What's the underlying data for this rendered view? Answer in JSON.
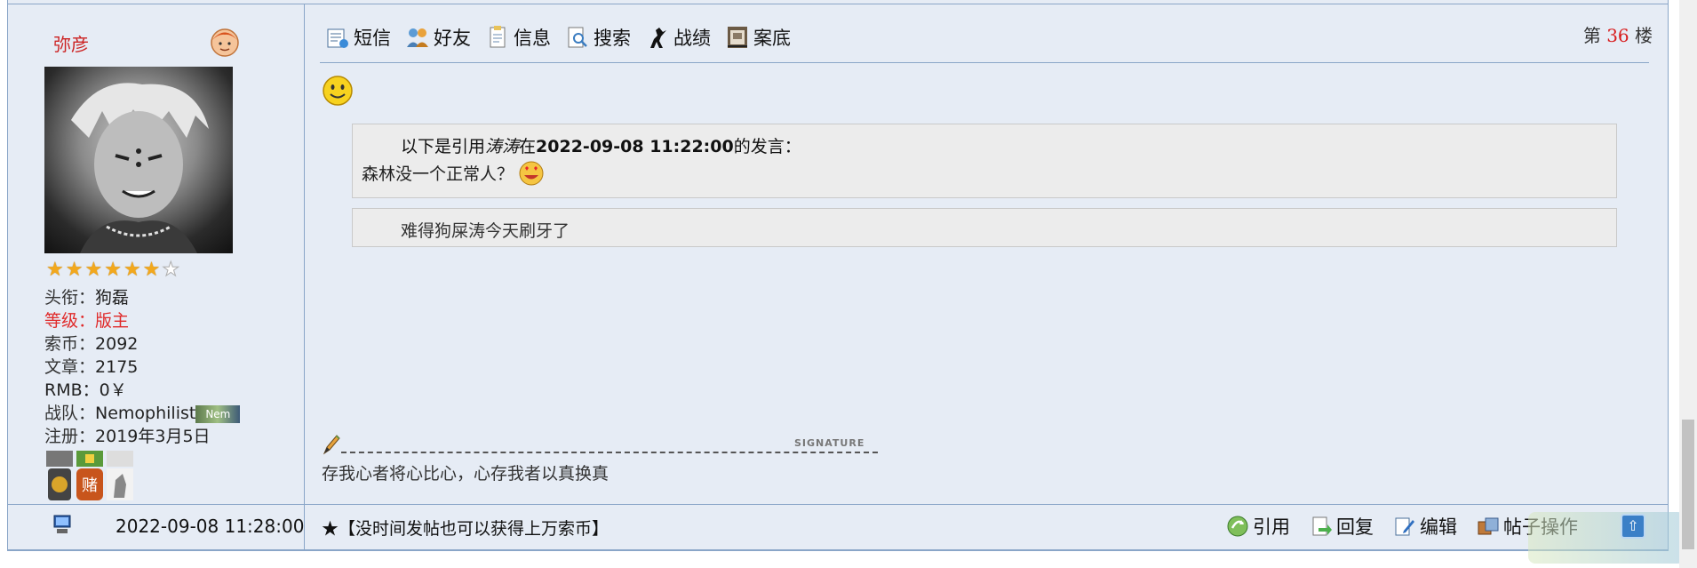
{
  "user": {
    "name": "弥彦",
    "rating": {
      "filled": 6,
      "total": 7
    },
    "info": [
      {
        "label": "头衔：",
        "value": "狗磊",
        "red": false
      },
      {
        "label": "等级：",
        "value": "版主",
        "red": true
      },
      {
        "label": "索币：",
        "value": "2092",
        "red": false
      },
      {
        "label": "文章：",
        "value": "2175",
        "red": false
      },
      {
        "label": "RMB：",
        "value": "0￥",
        "red": false
      },
      {
        "label": "战队：",
        "value": "Nemophilist",
        "red": false
      },
      {
        "label": "注册：",
        "value": "2019年3月5日",
        "red": false
      }
    ],
    "team_badge": "Nem"
  },
  "toolbar": {
    "items": [
      "短信",
      "好友",
      "信息",
      "搜索",
      "战绩",
      "案底"
    ]
  },
  "floor": {
    "prefix": "第",
    "number": "36",
    "suffix": "楼"
  },
  "quote": {
    "intro": "以下是引用",
    "author": "涛涛",
    "at": "在",
    "datetime": "2022-09-08 11:22:00",
    "suffix": "的发言：",
    "text": "森林没一个正常人？"
  },
  "reply_text": "难得狗屎涛今天刷牙了",
  "signature": {
    "label": "SIGNATURE",
    "text": "存我心者将心比心，心存我者以真换真"
  },
  "footer": {
    "post_time": "2022-09-08 11:28:00",
    "notice": "★【没时间发帖也可以获得上万索币】",
    "actions": [
      "引用",
      "回复",
      "编辑",
      "帖子操作"
    ]
  },
  "colors": {
    "accent_red": "#d81b1b",
    "border_blue": "#8aa6c8",
    "panel_bg": "#e6ecf5"
  }
}
